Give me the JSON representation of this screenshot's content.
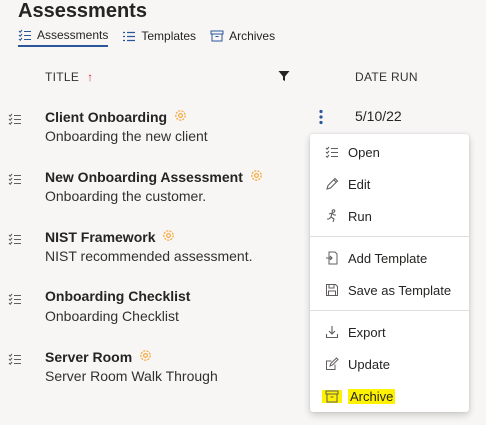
{
  "page": {
    "title": "Assessments"
  },
  "tabs": [
    {
      "label": "Assessments",
      "icon": "checklist-icon",
      "active": true
    },
    {
      "label": "Templates",
      "icon": "list-icon",
      "active": false
    },
    {
      "label": "Archives",
      "icon": "archive-box-icon",
      "active": false
    }
  ],
  "columns": {
    "title": "TITLE",
    "date_run": "DATE RUN",
    "sort_icon": "sort-up-arrow",
    "filter_icon": "filter-funnel-icon"
  },
  "rows": [
    {
      "title": "Client Onboarding",
      "description": "Onboarding the new client",
      "date": "5/10/22",
      "has_gear": true
    },
    {
      "title": "New Onboarding Assessment",
      "description": "Onboarding the customer.",
      "date": "",
      "has_gear": true
    },
    {
      "title": "NIST Framework",
      "description": "NIST recommended assessment.",
      "date": "",
      "has_gear": true
    },
    {
      "title": "Onboarding Checklist",
      "description": "Onboarding Checklist",
      "date": "",
      "has_gear": false
    },
    {
      "title": "Server Room",
      "description": "Server Room Walk Through",
      "date": "",
      "has_gear": true
    }
  ],
  "context_menu": {
    "items": [
      {
        "label": "Open",
        "icon": "checklist-icon"
      },
      {
        "label": "Edit",
        "icon": "pencil-icon"
      },
      {
        "label": "Run",
        "icon": "run-icon"
      },
      {
        "label": "Add Template",
        "icon": "add-template-icon"
      },
      {
        "label": "Save as Template",
        "icon": "save-icon"
      },
      {
        "label": "Export",
        "icon": "export-icon"
      },
      {
        "label": "Update",
        "icon": "update-icon"
      },
      {
        "label": "Archive",
        "icon": "archive-box-icon",
        "highlighted": true
      }
    ]
  },
  "colors": {
    "accent": "#2b579a",
    "gear": "#f7a433",
    "kebab": "#2b579a",
    "sort_arrow": "#d13438",
    "highlight": "#fff200"
  }
}
